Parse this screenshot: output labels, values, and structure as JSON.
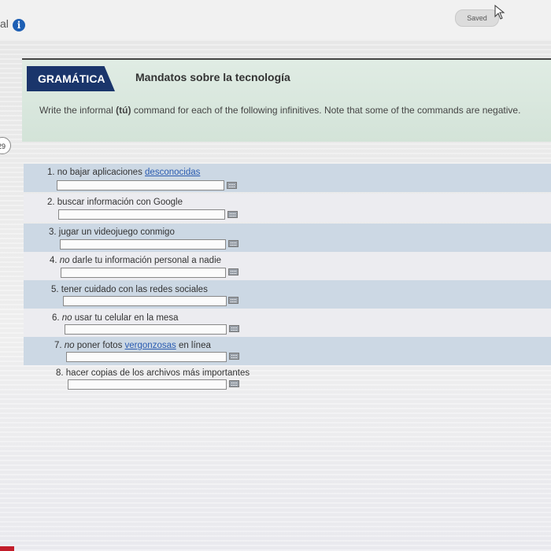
{
  "topbar": {
    "nav_fragment": "al",
    "info_icon": "info-icon",
    "saved_label": "Saved"
  },
  "side_badge": "29",
  "section": {
    "tab_label": "GRAMÁTICA",
    "title": "Mandatos sobre la tecnología",
    "instructions_before": "Write the informal ",
    "instructions_tu": "(tú)",
    "instructions_after": " command for each of the following infinitives. Note that some of the commands are negative."
  },
  "items": [
    {
      "number": "1.",
      "neg": "",
      "text": " no bajar aplicaciones ",
      "link": "desconocidas",
      "after": "",
      "answer": ""
    },
    {
      "number": "2.",
      "neg": "",
      "text": " buscar información con Google",
      "link": "",
      "after": "",
      "answer": ""
    },
    {
      "number": "3.",
      "neg": "",
      "text": " jugar un videojuego conmigo",
      "link": "",
      "after": "",
      "answer": ""
    },
    {
      "number": "4.",
      "neg": " no",
      "text": " darle tu información personal a nadie",
      "link": "",
      "after": "",
      "answer": ""
    },
    {
      "number": "5.",
      "neg": "",
      "text": " tener cuidado con las redes sociales",
      "link": "",
      "after": "",
      "answer": ""
    },
    {
      "number": "6.",
      "neg": " no",
      "text": " usar tu celular en la mesa",
      "link": "",
      "after": "",
      "answer": ""
    },
    {
      "number": "7.",
      "neg": " no",
      "text": " poner fotos ",
      "link": "vergonzosas",
      "after": " en línea",
      "answer": ""
    },
    {
      "number": "8.",
      "neg": "",
      "text": " hacer copias de los archivos más importantes",
      "link": "",
      "after": "",
      "answer": ""
    }
  ],
  "colors": {
    "tab": "#1a356b",
    "header_bg": "#d8e7dc",
    "band_shade": "#ccd8e4",
    "link": "#2a5bb0"
  }
}
